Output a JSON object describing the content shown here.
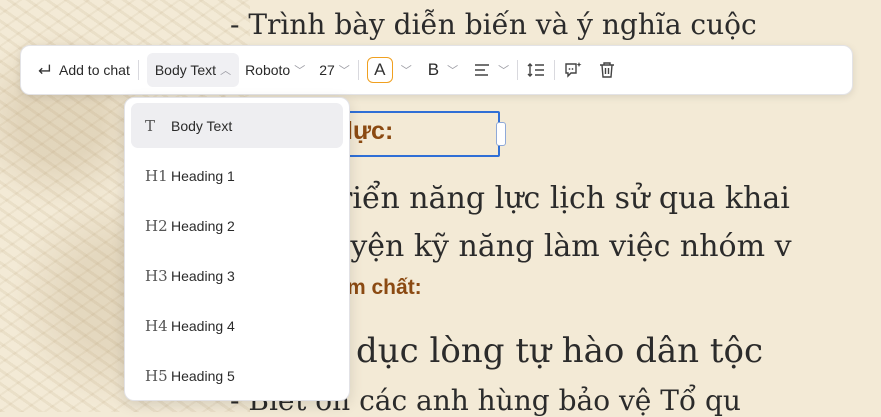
{
  "document": {
    "top_line": "- Trình bày diễn biến và ý nghĩa cuộc",
    "selected_heading": "lực:",
    "line1": "triển năng lực lịch sử qua khai",
    "line2": "uyện kỹ năng làm việc nhóm v",
    "heading2": "m chất:",
    "line3": "dục lòng tự hào dân tộc",
    "bottom_line": "- Biết ơn các anh hùng bảo vệ Tổ qu"
  },
  "toolbar": {
    "add_to_chat": "Add to chat",
    "text_style": "Body Text",
    "font": "Roboto",
    "font_size": "27",
    "text_color_label": "A",
    "bold_label": "B",
    "accent_color": "#f0a020"
  },
  "dropdown": {
    "items": [
      {
        "icon": "T",
        "label": "Body Text",
        "selected": true
      },
      {
        "icon": "H1",
        "label": "Heading 1"
      },
      {
        "icon": "H2",
        "label": "Heading 2"
      },
      {
        "icon": "H3",
        "label": "Heading 3"
      },
      {
        "icon": "H4",
        "label": "Heading 4"
      },
      {
        "icon": "H5",
        "label": "Heading 5"
      }
    ]
  }
}
